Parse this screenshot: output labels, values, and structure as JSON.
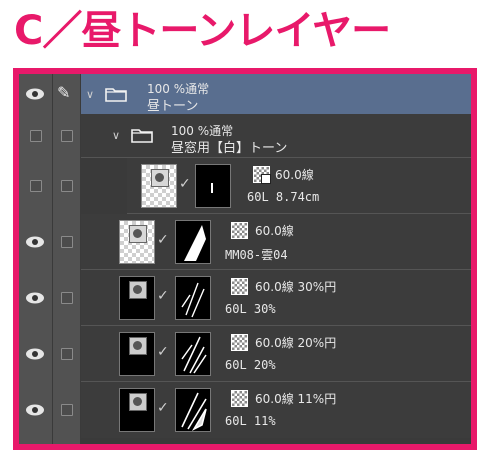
{
  "title": "C／昼トーンレイヤー",
  "colors": {
    "accent": "#e8196a",
    "panel_bg": "#3a3a3a",
    "selected": "#596e8f"
  },
  "layers": [
    {
      "name_line1": "100 %通常",
      "name_line2": "昼トーン",
      "type": "folder",
      "selected": true
    },
    {
      "name_line1": "100 %通常",
      "name_line2": "昼窓用【白】トーン",
      "type": "folder"
    },
    {
      "tone_label": "60.0線",
      "info_label": "60L 8.74cm",
      "type": "tone"
    },
    {
      "tone_label": "60.0線",
      "info_label": "MM08-雲04",
      "type": "tone"
    },
    {
      "tone_label": "60.0線 30%円",
      "info_label": "60L 30%",
      "type": "tone"
    },
    {
      "tone_label": "60.0線 20%円",
      "info_label": "60L 20%",
      "type": "tone"
    },
    {
      "tone_label": "60.0線 11%円",
      "info_label": "60L 11%",
      "type": "tone"
    }
  ],
  "icons": {
    "eye": "eye-icon",
    "pen": "pen-icon",
    "lock": "lock-checkbox",
    "folder": "folder-icon",
    "caret": "chevron-down-icon"
  }
}
